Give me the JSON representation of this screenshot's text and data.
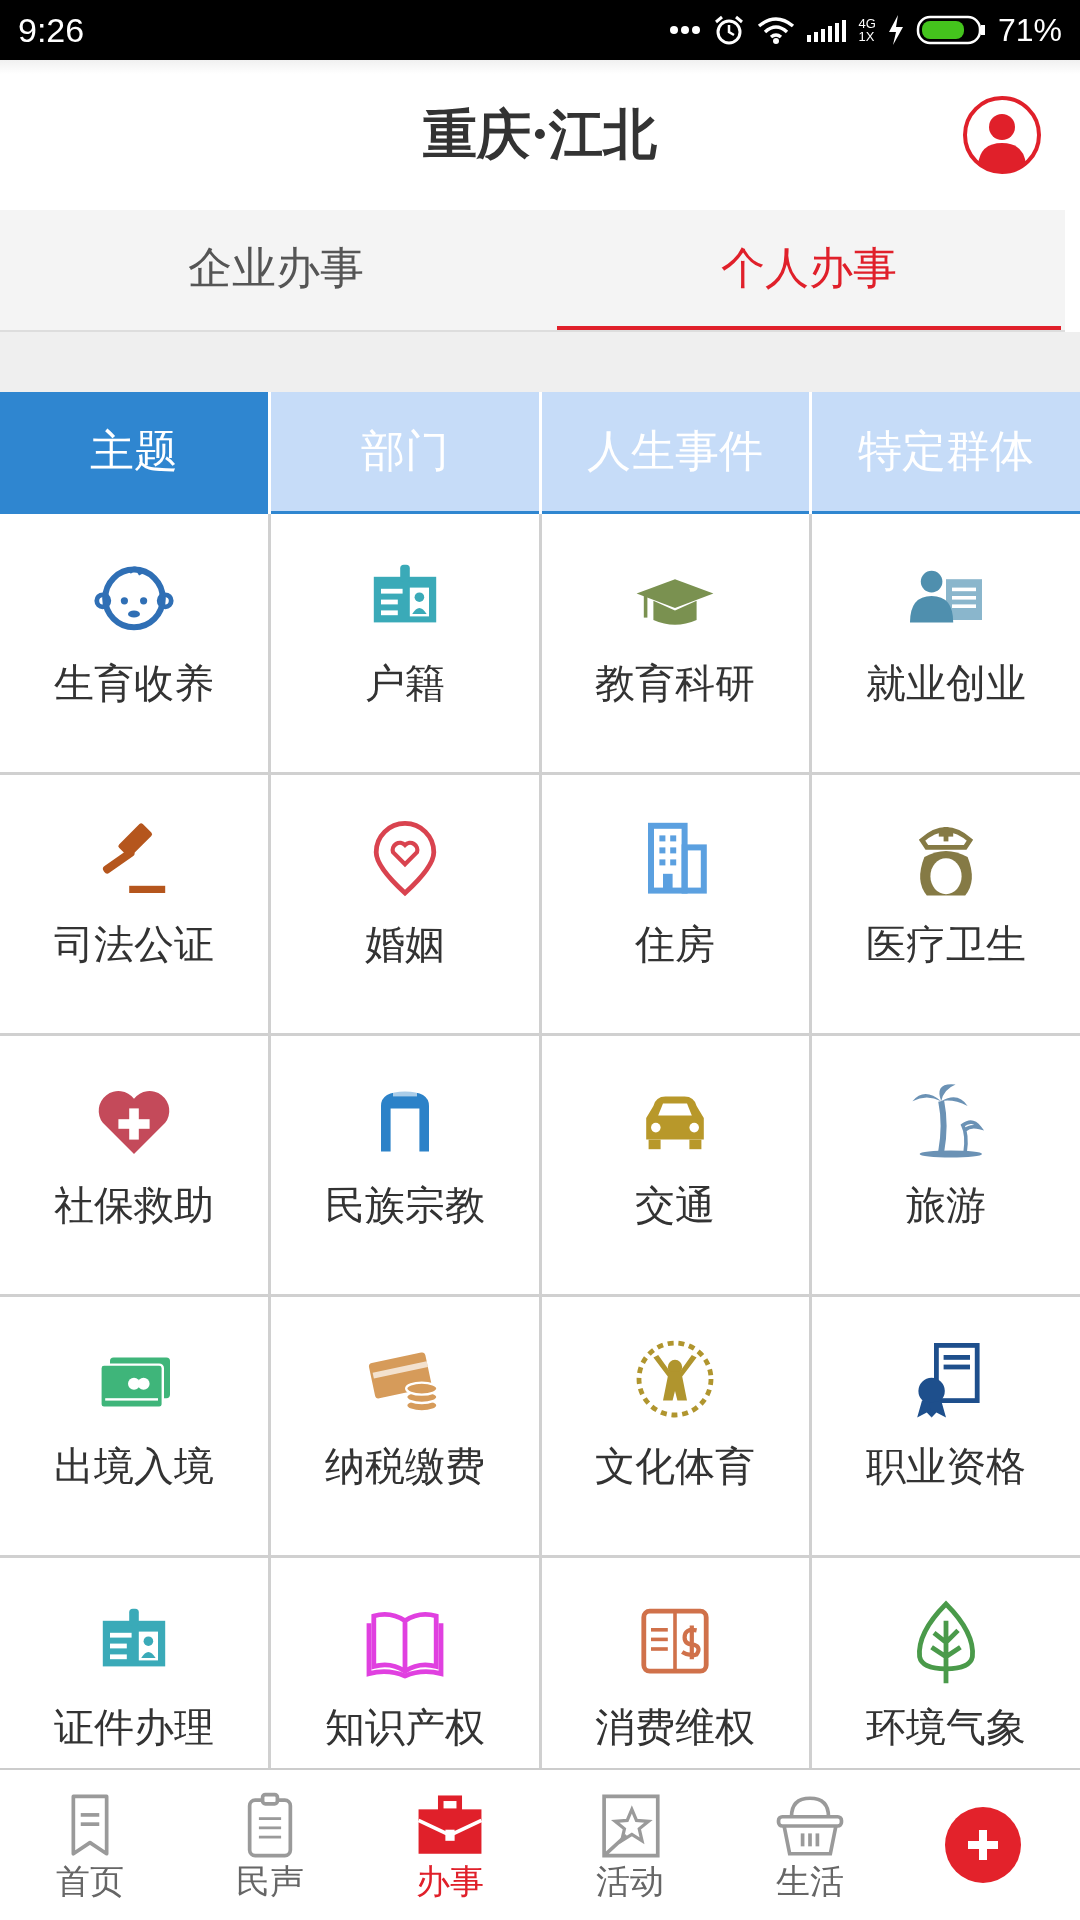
{
  "status_bar": {
    "time": "9:26",
    "network_top": "4G",
    "network_bottom": "1X",
    "battery": "71%"
  },
  "header": {
    "title": "重庆·江北"
  },
  "main_tabs": [
    {
      "label": "企业办事",
      "selected": false
    },
    {
      "label": "个人办事",
      "selected": true
    }
  ],
  "sub_tabs": [
    {
      "label": "主题",
      "selected": true
    },
    {
      "label": "部门",
      "selected": false
    },
    {
      "label": "人生事件",
      "selected": false
    },
    {
      "label": "特定群体",
      "selected": false
    }
  ],
  "services": [
    {
      "label": "生育收养"
    },
    {
      "label": "户籍"
    },
    {
      "label": "教育科研"
    },
    {
      "label": "就业创业"
    },
    {
      "label": "司法公证"
    },
    {
      "label": "婚姻"
    },
    {
      "label": "住房"
    },
    {
      "label": "医疗卫生"
    },
    {
      "label": "社保救助"
    },
    {
      "label": "民族宗教"
    },
    {
      "label": "交通"
    },
    {
      "label": "旅游"
    },
    {
      "label": "出境入境"
    },
    {
      "label": "纳税缴费"
    },
    {
      "label": "文化体育"
    },
    {
      "label": "职业资格"
    },
    {
      "label": "证件办理"
    },
    {
      "label": "知识产权"
    },
    {
      "label": "消费维权"
    },
    {
      "label": "环境气象"
    }
  ],
  "bottom_nav": [
    {
      "label": "首页",
      "selected": false
    },
    {
      "label": "民声",
      "selected": false
    },
    {
      "label": "办事",
      "selected": true
    },
    {
      "label": "活动",
      "selected": false
    },
    {
      "label": "生活",
      "selected": false
    }
  ]
}
